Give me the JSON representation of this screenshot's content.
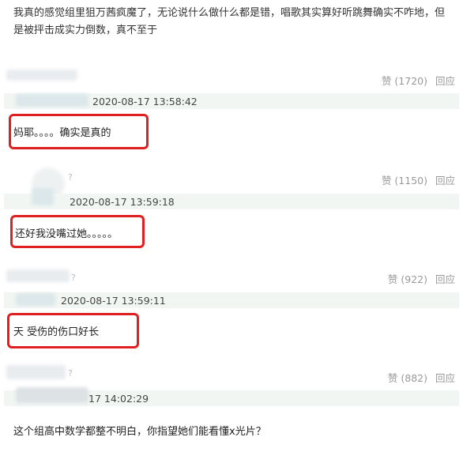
{
  "post": {
    "text": "我真的感觉组里狙万茜疯魔了，无论说什么做什么都是错，唱歌其实算好听跳舞确实不咋地，但是被抨击成实力倒数，真不至于"
  },
  "comments": [
    {
      "likes": "赞 (1720)",
      "reply_label": "回应",
      "timestamp": "2020-08-17 13:58:42",
      "text": "妈耶。。。。确实是真的"
    },
    {
      "likes": "赞 (1150)",
      "reply_label": "回应",
      "timestamp": "2020-08-17 13:59:18",
      "text": "还好我没嘴过她。。。。。"
    },
    {
      "likes": "赞 (922)",
      "reply_label": "回应",
      "timestamp": "2020-08-17 13:59:11",
      "text": "天 受伤的伤口好长"
    },
    {
      "likes": "赞 (882)",
      "reply_label": "回应",
      "timestamp": "17 14:02:29",
      "text": "这个组高中数学都整不明白，你指望她们能看懂x光片？"
    }
  ],
  "colors": {
    "highlight": "#e02020",
    "meta_bar": "#f2f6f3",
    "muted": "#999999"
  }
}
